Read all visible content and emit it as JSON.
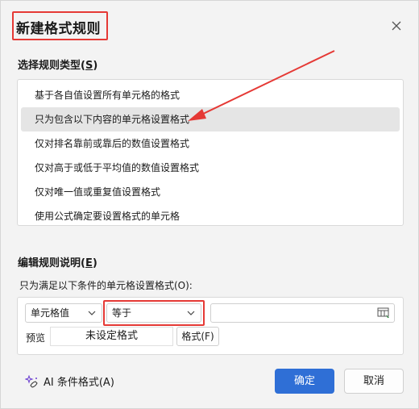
{
  "dialog": {
    "title": "新建格式规则",
    "close_icon": "close-icon"
  },
  "rule_type": {
    "label": "选择规则类型",
    "mnemonic": "S",
    "items": [
      {
        "label": "基于各自值设置所有单元格的格式",
        "selected": false
      },
      {
        "label": "只为包含以下内容的单元格设置格式",
        "selected": true
      },
      {
        "label": "仅对排名靠前或靠后的数值设置格式",
        "selected": false
      },
      {
        "label": "仅对高于或低于平均值的数值设置格式",
        "selected": false
      },
      {
        "label": "仅对唯一值或重复值设置格式",
        "selected": false
      },
      {
        "label": "使用公式确定要设置格式的单元格",
        "selected": false
      }
    ]
  },
  "rule_desc": {
    "label": "编辑规则说明",
    "mnemonic": "E",
    "condition_label": "只为满足以下条件的单元格设置格式(O):",
    "field_select": "单元格值",
    "operator_select": "等于",
    "value_input": "",
    "preview_label": "预览",
    "preview_text": "未设定格式",
    "format_button": "格式(F)"
  },
  "footer": {
    "ai_link": "AI 条件格式(A)",
    "ok_button": "确定",
    "cancel_button": "取消"
  },
  "colors": {
    "accent": "#2f6fd6",
    "highlight": "#e53935"
  }
}
